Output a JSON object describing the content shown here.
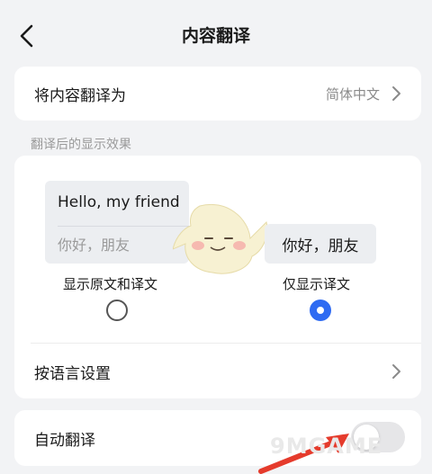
{
  "header": {
    "title": "内容翻译"
  },
  "translate_to": {
    "label": "将内容翻译为",
    "value": "简体中文"
  },
  "section_label": "翻译后的显示效果",
  "display": {
    "option_a": {
      "preview_original": "Hello, my friend",
      "preview_translation": "你好，朋友",
      "label": "显示原文和译文",
      "selected": false
    },
    "option_b": {
      "preview_translation": "你好，朋友",
      "label": "仅显示译文",
      "selected": true
    },
    "language_settings_label": "按语言设置"
  },
  "auto_translate": {
    "label": "自动翻译",
    "enabled": false
  },
  "watermark": "9MGAME",
  "colors": {
    "accent": "#2f6bf2",
    "background": "#f2f3f5",
    "card": "#ffffff"
  },
  "icons": [
    "back-arrow-icon",
    "chevron-right-icon",
    "mascot-icon"
  ]
}
